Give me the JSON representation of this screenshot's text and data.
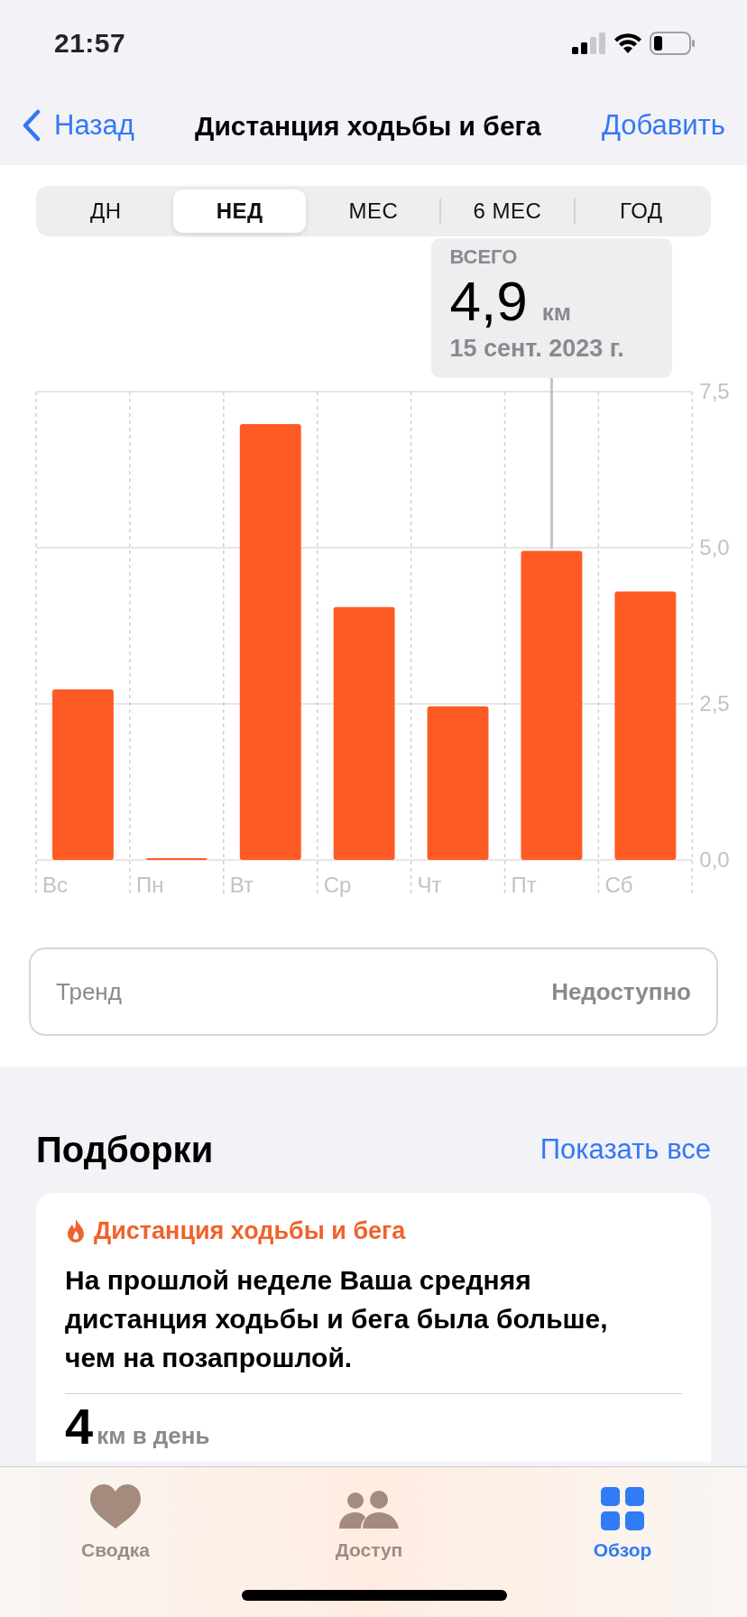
{
  "status_bar": {
    "time": "21:57"
  },
  "nav": {
    "back": "Назад",
    "title": "Дистанция ходьбы и бега",
    "action": "Добавить"
  },
  "periods": [
    {
      "label": "ДН",
      "selected": false
    },
    {
      "label": "НЕД",
      "selected": true
    },
    {
      "label": "МЕС",
      "selected": false
    },
    {
      "label": "6 МЕС",
      "selected": false
    },
    {
      "label": "ГОД",
      "selected": false
    }
  ],
  "tooltip": {
    "label": "ВСЕГО",
    "value": "4,9",
    "unit": "км",
    "date": "15 сент. 2023 г."
  },
  "chart_data": {
    "type": "bar",
    "categories": [
      "Вс",
      "Пн",
      "Вт",
      "Ср",
      "Чт",
      "Пт",
      "Сб"
    ],
    "values": [
      2.73,
      0.03,
      6.98,
      4.05,
      2.46,
      4.95,
      4.3
    ],
    "ylim": [
      0,
      7.5
    ],
    "yticks": [
      {
        "value": 0,
        "label": "0,0"
      },
      {
        "value": 2.5,
        "label": "2,5"
      },
      {
        "value": 5,
        "label": "5,0"
      },
      {
        "value": 7.5,
        "label": "7,5"
      }
    ]
  },
  "chart_bars": [
    {
      "selected": false
    },
    {
      "selected": false
    },
    {
      "selected": false
    },
    {
      "selected": false
    },
    {
      "selected": false
    },
    {
      "selected": true
    },
    {
      "selected": false
    }
  ],
  "trend": {
    "label": "Тренд",
    "value": "Недоступно"
  },
  "highlights": {
    "title": "Подборки",
    "show_all": "Показать все",
    "card": {
      "category": "Дистанция ходьбы и бега",
      "text": "На прошлой неделе Ваша средняя дистанция ходьбы и бега была больше, чем на позапрошлой.",
      "value": "4",
      "unit": "км в день"
    }
  },
  "tab_bar": [
    {
      "label": "Сводка",
      "kind": "summary",
      "selected": false
    },
    {
      "label": "Доступ",
      "kind": "sharing",
      "selected": false
    },
    {
      "label": "Обзор",
      "kind": "browse",
      "selected": true
    }
  ]
}
